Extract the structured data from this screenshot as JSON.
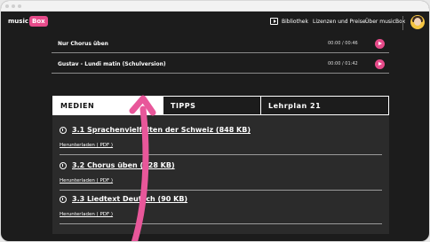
{
  "nav": {
    "logo_text": "music",
    "logo_box": "Box",
    "links": [
      "Bibliothek",
      "Lizenzen und Preise",
      "Über musicBox"
    ]
  },
  "tracks": [
    {
      "title": "Nur Chorus üben",
      "time": "00:00 / 00:46"
    },
    {
      "title": "Gustav - Lundi matin (Schulversion)",
      "time": "00:00 / 01:42"
    }
  ],
  "tabs": [
    "MEDIEN",
    "TIPPS",
    "Lehrplan 21"
  ],
  "items": [
    {
      "title": "3.1 Sprachenvielfalten der Schweiz (848 KB)",
      "sub": "Herunterladen ( PDF )"
    },
    {
      "title": "3.2 Chorus üben (228 KB)",
      "sub": "Herunterladen ( PDF )"
    },
    {
      "title": "3.3 Liedtext Deutsch (90 KB)",
      "sub": "Herunterladen ( PDF )"
    }
  ],
  "colors": {
    "accent": "#e64b8a",
    "background": "#1c1c1c"
  }
}
